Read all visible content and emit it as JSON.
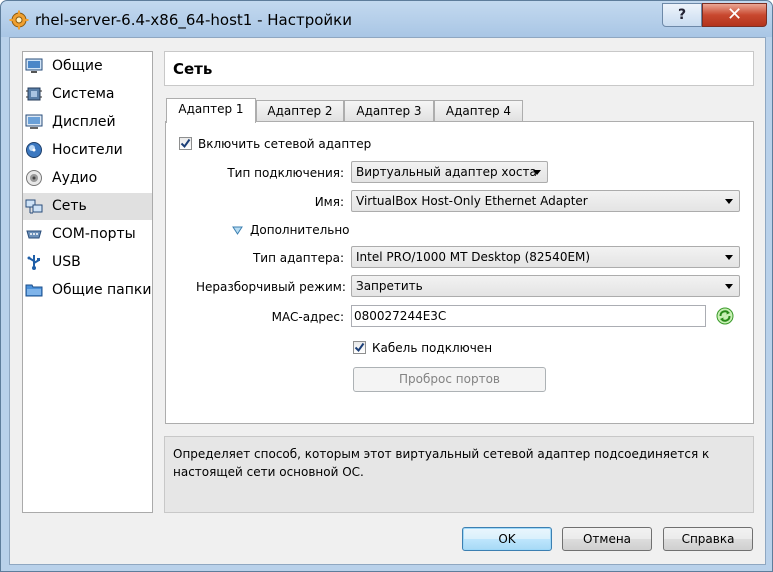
{
  "window": {
    "title": "rhel-server-6.4-x86_64-host1 - Настройки"
  },
  "titlebar": {
    "help_label": "?",
    "close_label": "✕"
  },
  "sidebar": {
    "items": [
      {
        "label": "Общие",
        "icon": "general-monitor-icon"
      },
      {
        "label": "Система",
        "icon": "system-chip-icon"
      },
      {
        "label": "Дисплей",
        "icon": "display-monitor-icon"
      },
      {
        "label": "Носители",
        "icon": "storage-disc-icon"
      },
      {
        "label": "Аудио",
        "icon": "audio-speaker-icon"
      },
      {
        "label": "Сеть",
        "icon": "network-icon",
        "selected": true
      },
      {
        "label": "COM-порты",
        "icon": "serial-port-icon"
      },
      {
        "label": "USB",
        "icon": "usb-icon"
      },
      {
        "label": "Общие папки",
        "icon": "shared-folder-icon"
      }
    ]
  },
  "section": {
    "title": "Сеть"
  },
  "tabs": [
    {
      "label": "Адаптер 1",
      "active": true
    },
    {
      "label": "Адаптер 2"
    },
    {
      "label": "Адаптер 3"
    },
    {
      "label": "Адаптер 4"
    }
  ],
  "adapter": {
    "enable_label": "Включить сетевой адаптер",
    "enable_checked": true,
    "attachment_label": "Тип подключения:",
    "attachment_value": "Виртуальный адаптер хоста",
    "name_label": "Имя:",
    "name_value": "VirtualBox Host-Only Ethernet Adapter",
    "advanced_label": "Дополнительно",
    "adapter_type_label": "Тип адаптера:",
    "adapter_type_value": "Intel PRO/1000 MT Desktop (82540EM)",
    "promisc_label": "Неразборчивый режим:",
    "promisc_value": "Запретить",
    "mac_label": "MAC-адрес:",
    "mac_value": "080027244E3C",
    "cable_label": "Кабель подключен",
    "cable_checked": true,
    "port_forwarding_label": "Проброс портов"
  },
  "info": {
    "text": "Определяет способ, которым этот виртуальный сетевой адаптер подсоединяется к настоящей сети основной ОС."
  },
  "footer": {
    "ok_label": "OK",
    "cancel_label": "Отмена",
    "help_label": "Справка"
  }
}
